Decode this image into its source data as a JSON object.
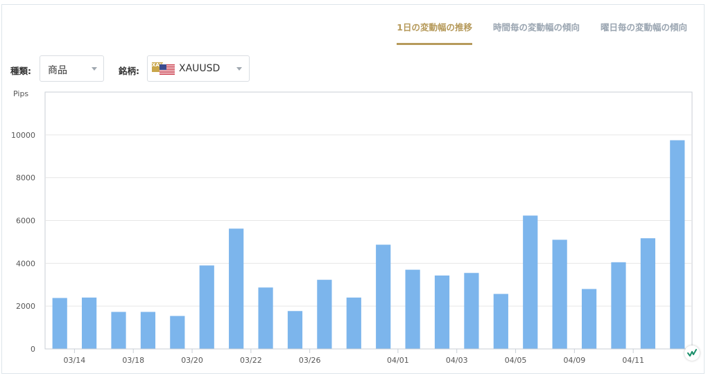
{
  "tabs": [
    {
      "label": "1日の変動幅の推移",
      "active": true
    },
    {
      "label": "時間毎の変動幅の傾向",
      "active": false
    },
    {
      "label": "曜日毎の変動幅の傾向",
      "active": false
    }
  ],
  "filters": {
    "type_label": "種類:",
    "type_value": "商品",
    "symbol_label": "銘柄:",
    "symbol_value": "XAUUSD",
    "symbol_icons": [
      "gold-flag-icon",
      "us-flag-icon"
    ],
    "gold_flag_text": "XAU"
  },
  "colors": {
    "accent": "#b69a5b",
    "bar": "#7cb5ec",
    "tab_inactive": "#9aa5b1"
  },
  "chart_data": {
    "type": "bar",
    "ylabel": "Pips",
    "ylim": [
      0,
      12000
    ],
    "yticks": [
      0,
      2000,
      4000,
      6000,
      8000,
      10000
    ],
    "grid": true,
    "values": [
      2380,
      2400,
      1730,
      1730,
      1540,
      3900,
      5620,
      2870,
      1770,
      3230,
      2400,
      4870,
      3700,
      3430,
      3550,
      2570,
      6230,
      5100,
      2800,
      4050,
      5170,
      9750
    ],
    "xticks": [
      {
        "label": "03/14",
        "pos": 1
      },
      {
        "label": "03/18",
        "pos": 3
      },
      {
        "label": "03/20",
        "pos": 5
      },
      {
        "label": "03/22",
        "pos": 7
      },
      {
        "label": "03/26",
        "pos": 9
      },
      {
        "label": "04/01",
        "pos": 12
      },
      {
        "label": "04/03",
        "pos": 14
      },
      {
        "label": "04/05",
        "pos": 16
      },
      {
        "label": "04/09",
        "pos": 18
      },
      {
        "label": "04/11",
        "pos": 20
      }
    ]
  }
}
